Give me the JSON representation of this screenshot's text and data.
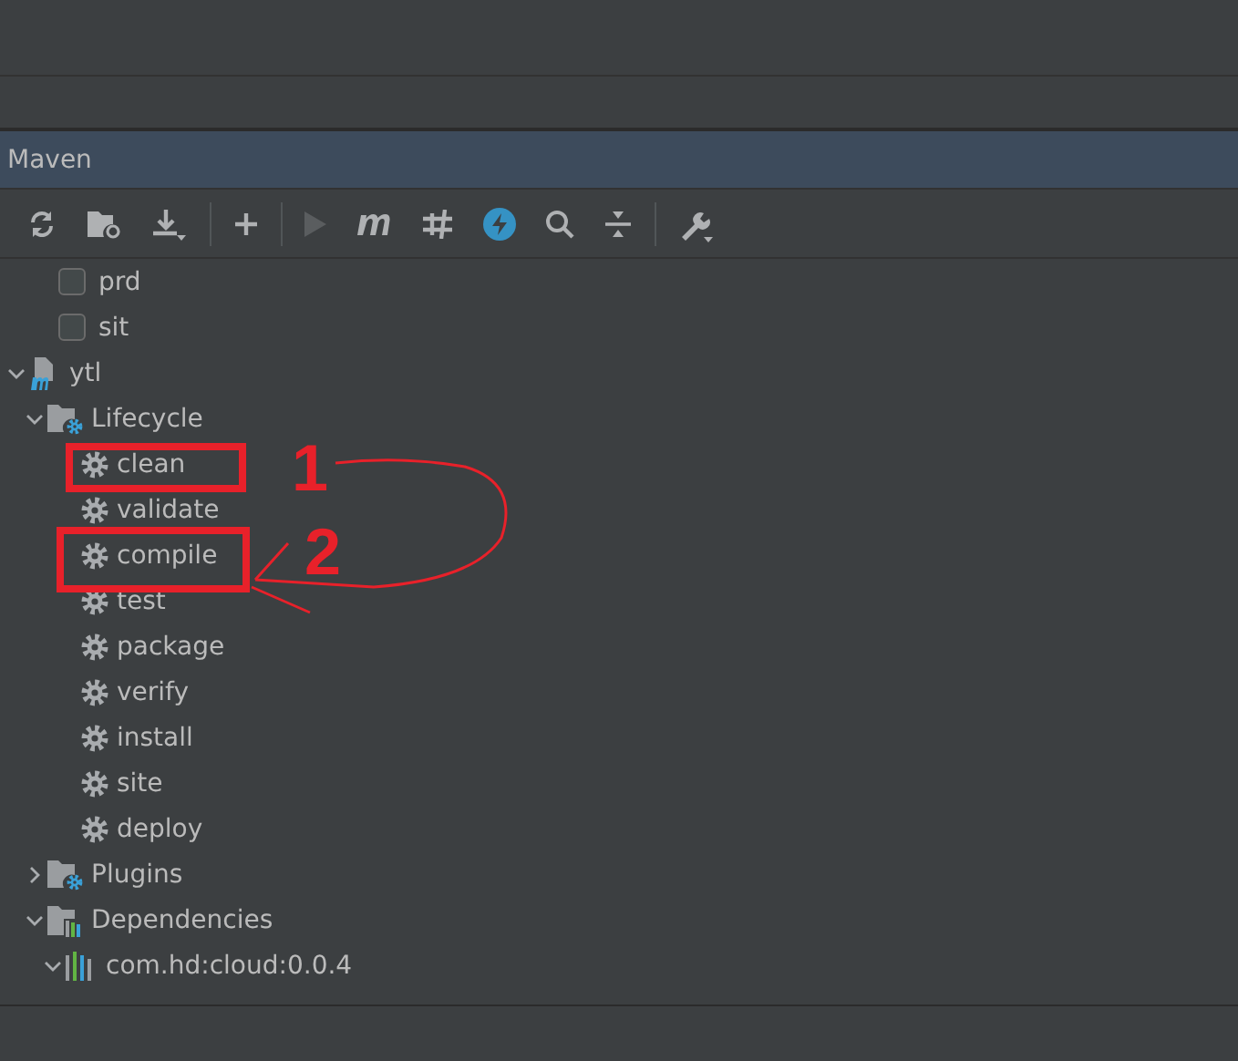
{
  "panel": {
    "title": "Maven"
  },
  "toolbar": [
    {
      "kind": "refresh",
      "disabled": false
    },
    {
      "kind": "folder-refresh",
      "disabled": false
    },
    {
      "kind": "download",
      "disabled": false
    },
    {
      "kind": "sep"
    },
    {
      "kind": "add",
      "disabled": false
    },
    {
      "kind": "sep"
    },
    {
      "kind": "run",
      "disabled": true
    },
    {
      "kind": "m",
      "disabled": false
    },
    {
      "kind": "skip",
      "disabled": false
    },
    {
      "kind": "bolt",
      "disabled": false
    },
    {
      "kind": "search",
      "disabled": false
    },
    {
      "kind": "collapse",
      "disabled": false
    },
    {
      "kind": "sep"
    },
    {
      "kind": "wrench",
      "disabled": false
    }
  ],
  "profiles": [
    {
      "label": "prd",
      "checked": false
    },
    {
      "label": "sit",
      "checked": false
    }
  ],
  "tree": [
    {
      "kind": "project",
      "label": "ytl",
      "expanded": true,
      "children": [
        {
          "kind": "lifecycle",
          "label": "Lifecycle",
          "expanded": true,
          "children": [
            {
              "kind": "goal",
              "label": "clean"
            },
            {
              "kind": "goal",
              "label": "validate"
            },
            {
              "kind": "goal",
              "label": "compile"
            },
            {
              "kind": "goal",
              "label": "test"
            },
            {
              "kind": "goal",
              "label": "package"
            },
            {
              "kind": "goal",
              "label": "verify"
            },
            {
              "kind": "goal",
              "label": "install"
            },
            {
              "kind": "goal",
              "label": "site"
            },
            {
              "kind": "goal",
              "label": "deploy"
            }
          ]
        },
        {
          "kind": "plugins",
          "label": "Plugins",
          "expanded": false
        },
        {
          "kind": "dependencies",
          "label": "Dependencies",
          "expanded": true,
          "children": [
            {
              "kind": "dependency",
              "label": "com.hd:cloud:0.0.4",
              "expanded": true
            }
          ]
        }
      ]
    }
  ],
  "annotations": [
    {
      "label": "1"
    },
    {
      "label": "2"
    }
  ]
}
